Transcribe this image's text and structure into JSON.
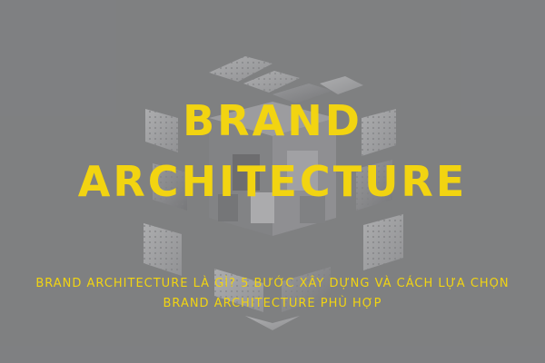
{
  "image": {
    "title_line_1": "BRAND",
    "title_line_2": "ARCHITECTURE",
    "subtitle_line_1": "BRAND ARCHITECTURE LÀ GÌ? 5 BƯỚC XÂY DỰNG VÀ CÁCH LỰA CHỌN",
    "subtitle_line_2": "BRAND ARCHITECTURE PHÙ HỢP"
  },
  "colors": {
    "background": "#8a8b8c",
    "accent_text": "#f2d411",
    "panel_light": "#c9cacb",
    "panel_mid": "#a9aaab",
    "panel_dark": "#6f7072"
  },
  "icons": [
    "exploded-cube-illustration"
  ]
}
